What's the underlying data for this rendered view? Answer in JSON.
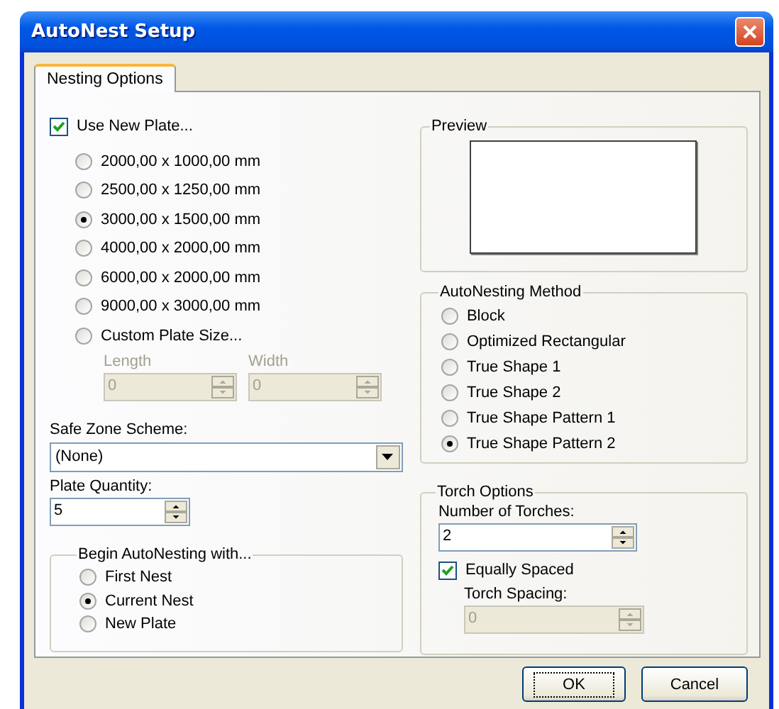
{
  "window": {
    "title": "AutoNest Setup"
  },
  "tabs": [
    {
      "label": "Nesting Options",
      "selected": true
    }
  ],
  "use_new_plate": {
    "label": "Use New Plate...",
    "checked": true
  },
  "plate_sizes": [
    {
      "label": "2000,00 x 1000,00 mm",
      "selected": false
    },
    {
      "label": "2500,00 x 1250,00 mm",
      "selected": false
    },
    {
      "label": "3000,00 x 1500,00 mm",
      "selected": true
    },
    {
      "label": "4000,00 x 2000,00 mm",
      "selected": false
    },
    {
      "label": "6000,00 x 2000,00 mm",
      "selected": false
    },
    {
      "label": "9000,00 x 3000,00 mm",
      "selected": false
    },
    {
      "label": "Custom Plate Size...",
      "selected": false
    }
  ],
  "custom_size_fields": [
    {
      "label": "Length",
      "value": "0",
      "disabled": true
    },
    {
      "label": "Width",
      "value": "0",
      "disabled": true
    }
  ],
  "safe_zone": {
    "label": "Safe Zone Scheme:",
    "value": "(None)"
  },
  "plate_quantity": {
    "label": "Plate Quantity:",
    "value": "5"
  },
  "begin_group": {
    "title": "Begin AutoNesting with...",
    "options": [
      {
        "label": "First Nest",
        "selected": false
      },
      {
        "label": "Current Nest",
        "selected": true
      },
      {
        "label": "New Plate",
        "selected": false
      }
    ]
  },
  "preview": {
    "title": "Preview"
  },
  "method_group": {
    "title": "AutoNesting Method",
    "options": [
      {
        "label": "Block",
        "selected": false
      },
      {
        "label": "Optimized Rectangular",
        "selected": false
      },
      {
        "label": "True Shape 1",
        "selected": false
      },
      {
        "label": "True Shape 2",
        "selected": false
      },
      {
        "label": "True Shape Pattern 1",
        "selected": false
      },
      {
        "label": "True Shape Pattern 2",
        "selected": true
      }
    ]
  },
  "torch_group": {
    "title": "Torch Options",
    "count": {
      "label": "Number of Torches:",
      "value": "2",
      "disabled": false
    },
    "equally_spaced": {
      "label": "Equally Spaced",
      "checked": true
    },
    "spacing": {
      "label": "Torch Spacing:",
      "value": "0",
      "disabled": true
    }
  },
  "buttons": [
    {
      "label": "OK",
      "default": true
    },
    {
      "label": "Cancel",
      "default": false
    }
  ]
}
